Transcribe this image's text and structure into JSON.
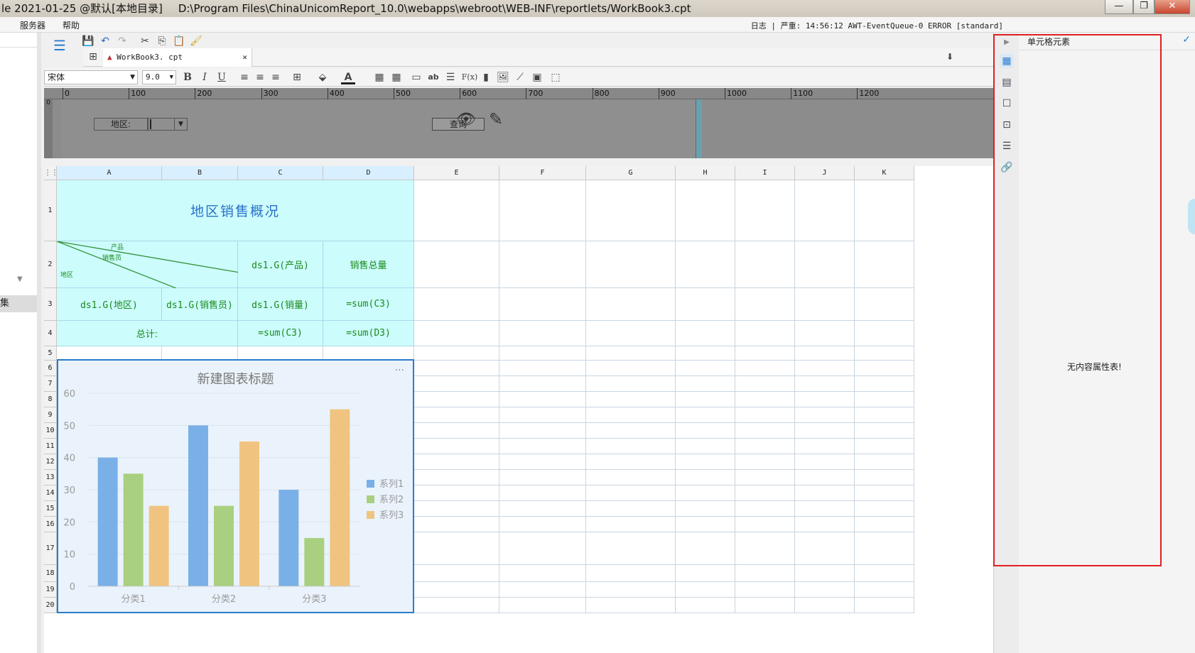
{
  "window": {
    "title": "le 2021-01-25 @默认[本地目录]",
    "path": "D:\\Program Files\\ChinaUnicomReport_10.0\\webapps\\webroot\\WEB-INF\\reportlets/WorkBook3.cpt",
    "minimize": "—",
    "restore": "❐",
    "close": "✕"
  },
  "menu": {
    "items": [
      "服务器",
      "帮助"
    ],
    "log_label": "日志",
    "log_severity": "严重",
    "log_message": "14:56:12 AWT-EventQueue-0 ERROR [standard]"
  },
  "tab": {
    "file": "WorkBook3. cpt",
    "close": "✕"
  },
  "format": {
    "font": "宋体",
    "size": "9.0",
    "bold": "B",
    "italic": "I",
    "underline": "U",
    "font_color_glyph": "A",
    "fx_glyph": "F(x)",
    "ab_glyph": "ab"
  },
  "ruler": {
    "labels": [
      "0",
      "100",
      "200",
      "300",
      "400",
      "500",
      "600",
      "700",
      "800",
      "900",
      "1000",
      "1100",
      "1200"
    ]
  },
  "param": {
    "region_label": "地区:",
    "query_button": "查询"
  },
  "grid": {
    "columns": [
      "A",
      "B",
      "C",
      "D",
      "E",
      "F",
      "G",
      "H",
      "I",
      "J",
      "K"
    ],
    "rows": [
      "1",
      "2",
      "3",
      "4",
      "5",
      "6",
      "7",
      "8",
      "9",
      "10",
      "11",
      "12",
      "13",
      "14",
      "15",
      "16",
      "17",
      "18",
      "19",
      "20"
    ],
    "cells": {
      "title": "地区销售概况",
      "diag_product": "产品",
      "diag_seller": "销售员",
      "diag_region": "地区",
      "c2": "ds1.G(产品)",
      "d2": "销售总量",
      "a3": "ds1.G(地区)",
      "b3": "ds1.G(销售员)",
      "c3": "ds1.G(销量)",
      "d3": "=sum(C3)",
      "a4": "总计:",
      "c4": "=sum(C3)",
      "d4": "=sum(D3)"
    }
  },
  "chart_data": {
    "type": "bar",
    "title": "新建图表标题",
    "categories": [
      "分类1",
      "分类2",
      "分类3"
    ],
    "series": [
      {
        "name": "系列1",
        "values": [
          40,
          50,
          30
        ],
        "color": "#7ab0e8"
      },
      {
        "name": "系列2",
        "values": [
          35,
          25,
          15
        ],
        "color": "#a8d080"
      },
      {
        "name": "系列3",
        "values": [
          25,
          45,
          55
        ],
        "color": "#f0c480"
      }
    ],
    "ylim": [
      0,
      60
    ],
    "yticks": [
      0,
      10,
      20,
      30,
      40,
      50,
      60
    ],
    "legend": "right",
    "grid": true,
    "more": "···"
  },
  "panel": {
    "header": "单元格元素",
    "empty_message": "无内容属性表!",
    "left_tab": "集"
  },
  "colors": {
    "accent_red": "#e02020",
    "cyan_cell": "#ccfcfc",
    "green_text": "#1a8a1a"
  }
}
